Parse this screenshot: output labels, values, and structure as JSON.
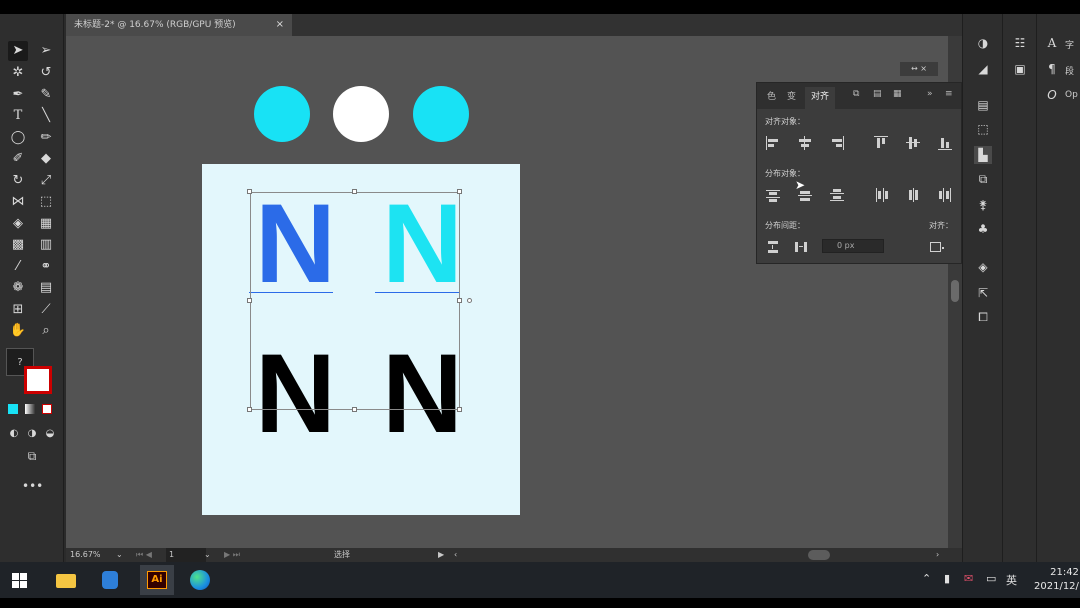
{
  "document_tab": {
    "title": "未标题-2* @ 16.67% (RGB/GPU 预览)",
    "close_symbol": "×"
  },
  "panel_tabs": [
    "色",
    "变",
    "对齐"
  ],
  "panel_tab_menu": "»",
  "panel_header_controls": "↔ ×",
  "align_panel": {
    "section_align_objects": "对齐对象：",
    "section_distribute_objects": "分布对象：",
    "section_distribute_spacing": "分布间距：",
    "align_to_label": "对齐：",
    "spacing_value": "0 px"
  },
  "artboard": {
    "letters": [
      "N",
      "N",
      "N",
      "N"
    ],
    "letter_colors": [
      "#2b6be8",
      "#1de3f2",
      "#000000",
      "#000000"
    ],
    "circle_colors": [
      "#18e2f5",
      "#ffffff",
      "#18e2f5"
    ]
  },
  "status_bar": {
    "zoom": "16.67%",
    "artboard_number": "1",
    "tool_name": "选择"
  },
  "right_dock": {
    "labels": [
      "字",
      "段",
      "Op"
    ]
  },
  "taskbar": {
    "apps": [
      "start-icon",
      "file-explorer-icon",
      "app-icon",
      "illustrator-icon",
      "edge-icon"
    ],
    "illustrator_label": "Ai",
    "ime": "英",
    "time": "21:42",
    "date": "2021/12/"
  },
  "colors": {
    "accent_blue": "#2b6be8",
    "accent_cyan": "#1de3f2",
    "artboard_bg": "#e3f7fc"
  }
}
